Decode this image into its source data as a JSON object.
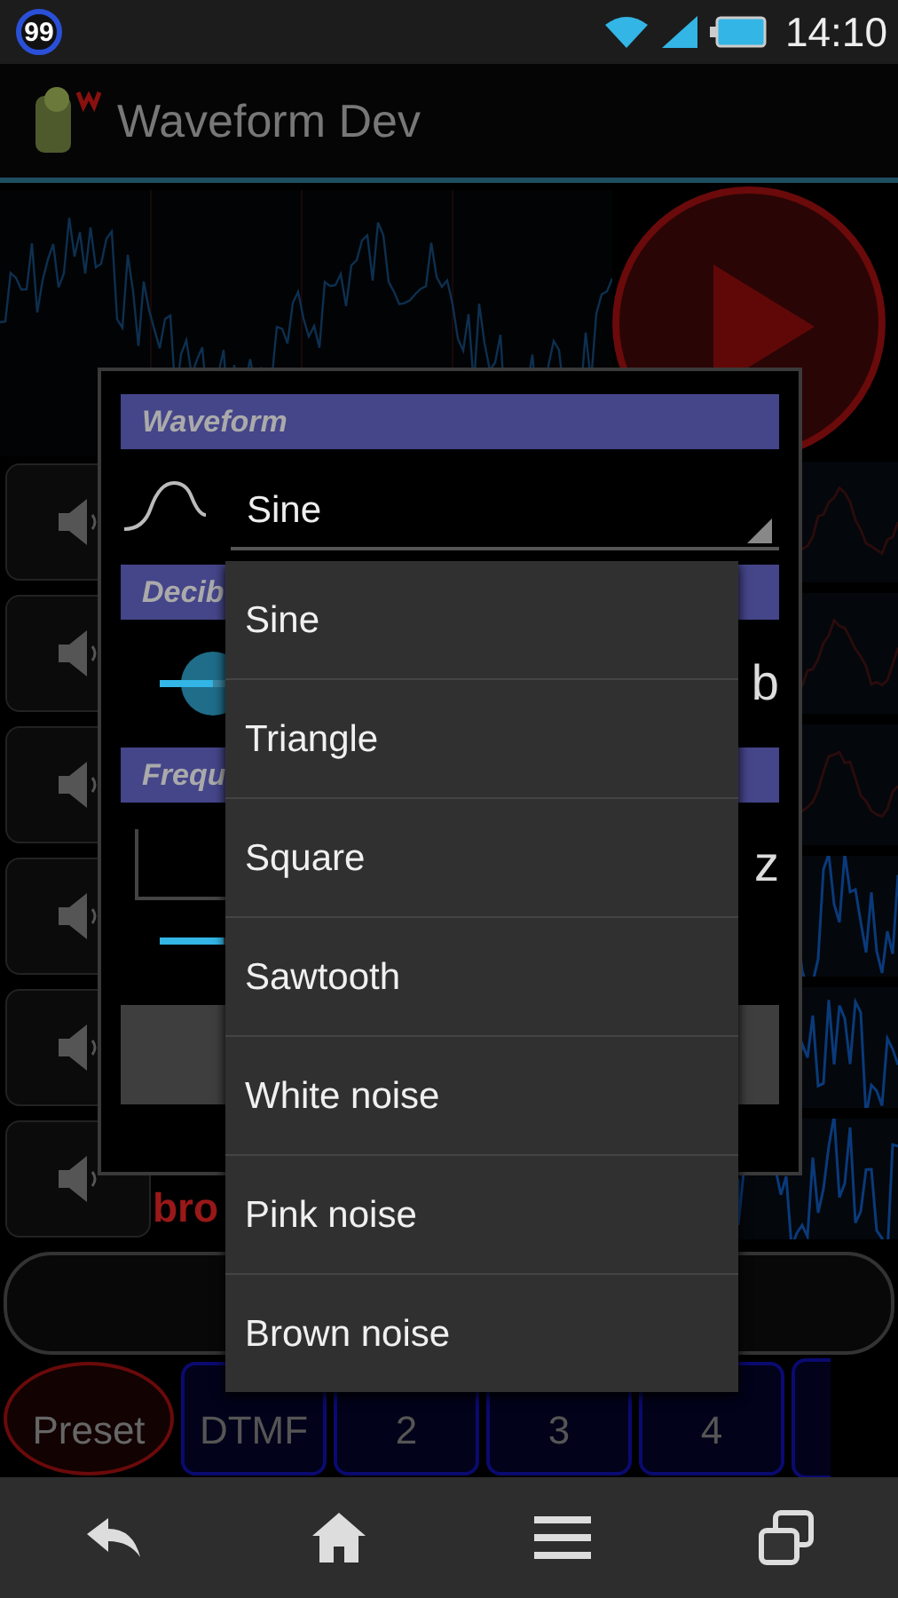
{
  "status_bar": {
    "badge": "99",
    "time": "14:10"
  },
  "app_bar": {
    "title": "Waveform Dev"
  },
  "channel_label": "bro",
  "tabs": [
    {
      "label": "Preset",
      "selected": true
    },
    {
      "label": "DTMF",
      "selected": false
    },
    {
      "label": "2",
      "selected": false
    },
    {
      "label": "3",
      "selected": false
    },
    {
      "label": "4",
      "selected": false
    }
  ],
  "dialog": {
    "waveform_header": "Waveform",
    "waveform_value": "Sine",
    "decibel_header": "Decib",
    "decibel_slider": {
      "level": 0.1
    },
    "decibel_unit": "b",
    "frequency_header": "Frequ",
    "frequency_unit": "z",
    "frequency_slider": {
      "level": 0.12
    }
  },
  "dropdown": {
    "options": [
      "Sine",
      "Triangle",
      "Square",
      "Sawtooth",
      "White noise",
      "Pink noise",
      "Brown noise"
    ]
  }
}
